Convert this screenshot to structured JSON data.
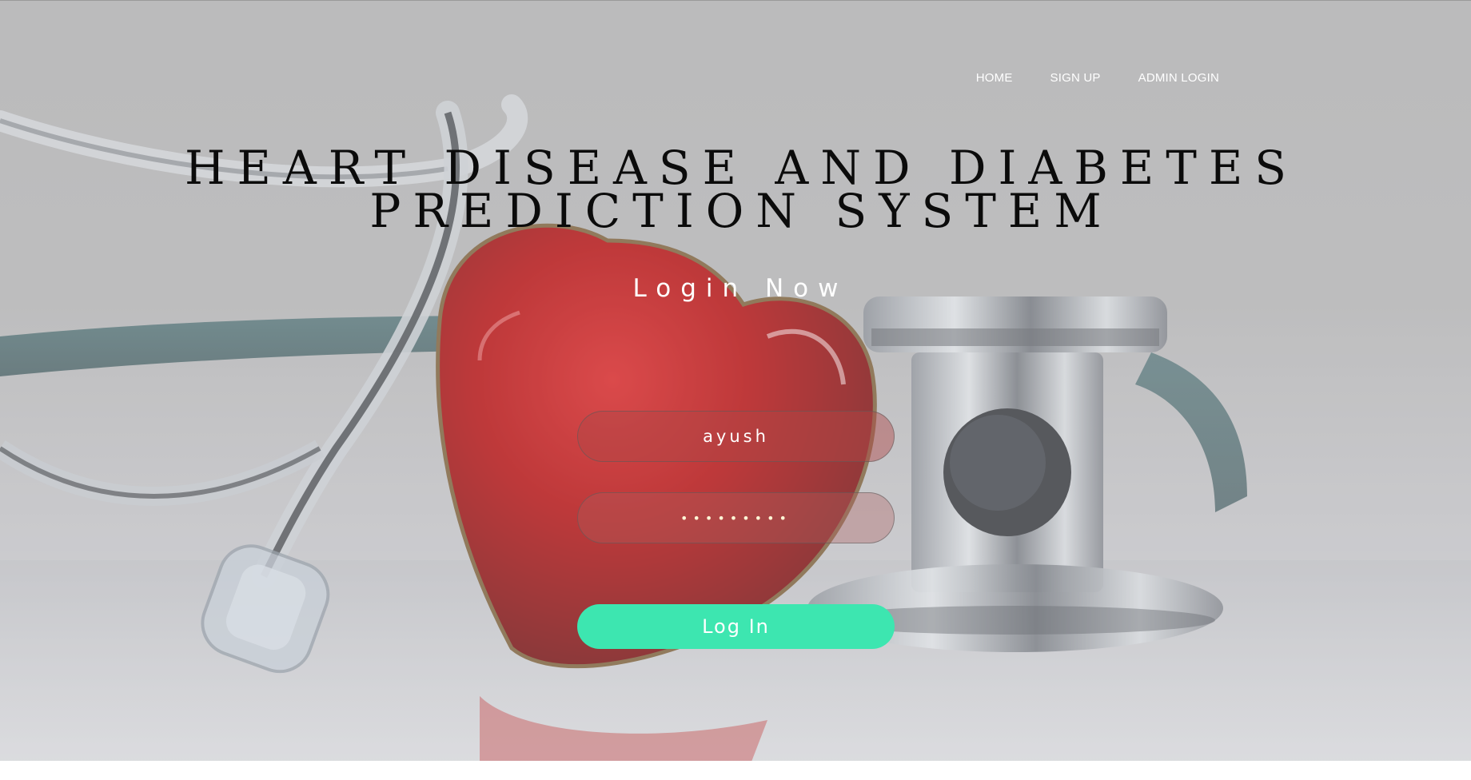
{
  "nav": {
    "items": [
      {
        "label": "HOME"
      },
      {
        "label": "SIGN UP"
      },
      {
        "label": "ADMIN LOGIN"
      }
    ]
  },
  "hero": {
    "title_line1": "HEART DISEASE AND DIABETES",
    "title_line2": "PREDICTION SYSTEM",
    "subtitle": "Login Now",
    "background_icons": [
      "stethoscope-icon",
      "heart-icon"
    ]
  },
  "form": {
    "username_value": "ayush",
    "password_value": "•••••••••",
    "button_label": "Log In"
  },
  "colors": {
    "button": "#3de6b0",
    "heart": "#c10000",
    "overlay": "#b4b4b4"
  }
}
